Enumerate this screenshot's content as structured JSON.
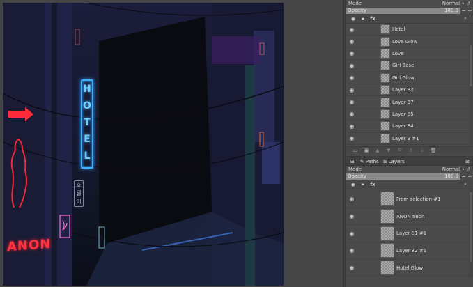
{
  "canvas": {
    "signs": {
      "hotel": [
        "H",
        "O",
        "T",
        "E",
        "L"
      ],
      "korean": [
        "호",
        "텔",
        "이"
      ],
      "anon": "ANON"
    },
    "colors": {
      "neon_blue": "#3fb0ff",
      "neon_red": "#ff2a3a",
      "neon_pink": "#ff6ad5"
    }
  },
  "top_panel": {
    "mode_label": "Mode",
    "mode_value": "Normal",
    "opacity_label": "Opacity",
    "opacity_value": "100.0",
    "opacity_fraction": 1.0,
    "layers": [
      {
        "name": "Hotel"
      },
      {
        "name": "Love Glow"
      },
      {
        "name": "Love"
      },
      {
        "name": "Girl Base"
      },
      {
        "name": "Girl Glow"
      },
      {
        "name": "Layer 82"
      },
      {
        "name": "Layer 37"
      },
      {
        "name": "Layer 85"
      },
      {
        "name": "Layer 84"
      },
      {
        "name": "Layer 3 #1"
      }
    ]
  },
  "tabs": [
    {
      "label": "Paths",
      "icon": "paths-icon"
    },
    {
      "label": "Layers",
      "icon": "layers-icon"
    }
  ],
  "bottom_panel": {
    "mode_label": "Mode",
    "mode_value": "Normal",
    "opacity_label": "Opacity",
    "opacity_value": "100.0",
    "opacity_fraction": 1.0,
    "layers": [
      {
        "name": "From selection #1"
      },
      {
        "name": "ANON neon"
      },
      {
        "name": "Layer 81 #1"
      },
      {
        "name": "Layer 82 #1"
      },
      {
        "name": "Hotel Glow"
      }
    ]
  },
  "icons": {
    "visibility": "eye-icon",
    "lock": "lock-icon",
    "effects": "fx-icon",
    "search": "search-icon"
  }
}
